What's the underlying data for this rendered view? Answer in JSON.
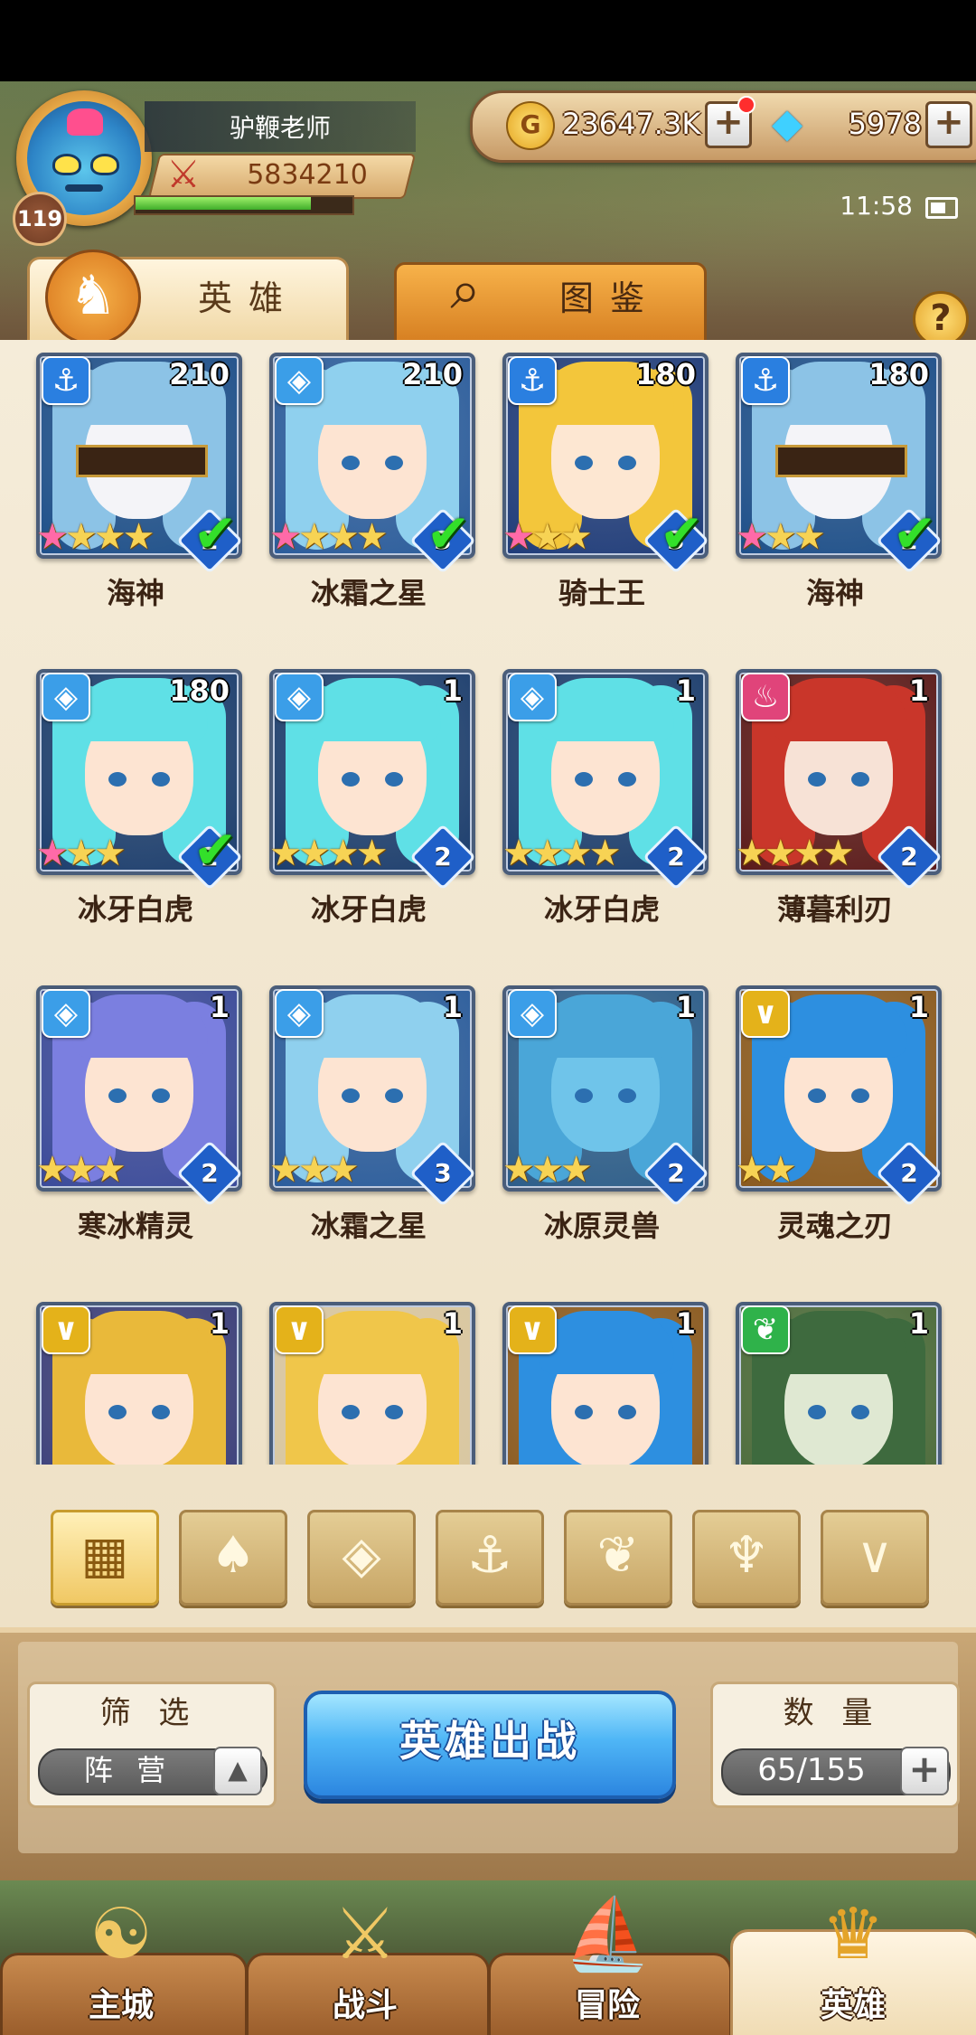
{
  "player": {
    "name": "驴鞭老师",
    "level": "119",
    "power": "5834210",
    "exp_fraction": 0.82
  },
  "resources": {
    "gold": "23647.3K",
    "gems": "5978"
  },
  "status": {
    "time": "11:58"
  },
  "tabs": {
    "heroes": "英雄",
    "atlas": "图鉴",
    "help": "?"
  },
  "heroes": [
    {
      "name": "海神",
      "level": "210",
      "faction": "anchor",
      "stars": 4,
      "rainbow": 1,
      "rank": "2",
      "checked": true,
      "hair": "#8cc3e6",
      "skin": "#f4f4f8",
      "bg": "#1d4f8a",
      "blind": true
    },
    {
      "name": "冰霜之星",
      "level": "210",
      "faction": "ice",
      "stars": 4,
      "rainbow": 1,
      "rank": "3",
      "checked": true,
      "hair": "#8fd0ee",
      "skin": "#fde4d2",
      "bg": "#2a5c9c",
      "blind": false
    },
    {
      "name": "骑士王",
      "level": "180",
      "faction": "anchor",
      "stars": 3,
      "rainbow": 1,
      "rank": "3",
      "checked": true,
      "hair": "#f3c63b",
      "skin": "#fde7d2",
      "bg": "#1f3c7a",
      "blind": false
    },
    {
      "name": "海神",
      "level": "180",
      "faction": "anchor",
      "stars": 3,
      "rainbow": 1,
      "rank": "2",
      "checked": true,
      "hair": "#8cc3e6",
      "skin": "#f4f4f8",
      "bg": "#1d4f8a",
      "blind": true
    },
    {
      "name": "冰牙白虎",
      "level": "180",
      "faction": "ice",
      "stars": 3,
      "rainbow": 1,
      "rank": "2",
      "checked": true,
      "hair": "#5fe0e6",
      "skin": "#fde4d2",
      "bg": "#1c3e6e",
      "blind": false
    },
    {
      "name": "冰牙白虎",
      "level": "1",
      "faction": "ice",
      "stars": 4,
      "rainbow": 0,
      "rank": "2",
      "checked": false,
      "hair": "#5fe0e6",
      "skin": "#fde4d2",
      "bg": "#1c3e6e",
      "blind": false
    },
    {
      "name": "冰牙白虎",
      "level": "1",
      "faction": "ice",
      "stars": 4,
      "rainbow": 0,
      "rank": "2",
      "checked": false,
      "hair": "#5fe0e6",
      "skin": "#fde4d2",
      "bg": "#1c3e6e",
      "blind": false
    },
    {
      "name": "薄暮利刃",
      "level": "1",
      "faction": "flame",
      "stars": 4,
      "rainbow": 0,
      "rank": "2",
      "checked": false,
      "hair": "#c9362a",
      "skin": "#f7e2d6",
      "bg": "#5a1a1a",
      "blind": false
    },
    {
      "name": "寒冰精灵",
      "level": "1",
      "faction": "ice",
      "stars": 3,
      "rainbow": 0,
      "rank": "2",
      "checked": false,
      "hair": "#7b7fe0",
      "skin": "#fde4d2",
      "bg": "#3a4a9a",
      "blind": false
    },
    {
      "name": "冰霜之星",
      "level": "1",
      "faction": "ice",
      "stars": 3,
      "rainbow": 0,
      "rank": "3",
      "checked": false,
      "hair": "#8fd0ee",
      "skin": "#fde4d2",
      "bg": "#2a5c9c",
      "blind": false
    },
    {
      "name": "冰原灵兽",
      "level": "1",
      "faction": "ice",
      "stars": 3,
      "rainbow": 0,
      "rank": "2",
      "checked": false,
      "hair": "#4aa6d8",
      "skin": "#6fc4ea",
      "bg": "#2c5d8a",
      "blind": false
    },
    {
      "name": "灵魂之刃",
      "level": "1",
      "faction": "wing",
      "stars": 2,
      "rainbow": 0,
      "rank": "2",
      "checked": false,
      "hair": "#2d8fe0",
      "skin": "#fde4d2",
      "bg": "#8a5a20",
      "blind": false
    },
    {
      "name": "",
      "level": "1",
      "faction": "wing",
      "stars": 0,
      "rainbow": 0,
      "rank": "",
      "checked": false,
      "hair": "#e9b93a",
      "skin": "#fde4d2",
      "bg": "#3a3e7a",
      "blind": false
    },
    {
      "name": "",
      "level": "1",
      "faction": "wing",
      "stars": 0,
      "rainbow": 0,
      "rank": "",
      "checked": false,
      "hair": "#f0c64a",
      "skin": "#fde4d2",
      "bg": "#d8c6a0",
      "blind": false
    },
    {
      "name": "",
      "level": "1",
      "faction": "wing",
      "stars": 0,
      "rainbow": 0,
      "rank": "",
      "checked": false,
      "hair": "#2d8fe0",
      "skin": "#fde4d2",
      "bg": "#8a5a20",
      "blind": false
    },
    {
      "name": "",
      "level": "1",
      "faction": "beast",
      "stars": 0,
      "rainbow": 0,
      "rank": "",
      "checked": false,
      "hair": "#3e6a3e",
      "skin": "#dfe8d2",
      "bg": "#4a6a3a",
      "blind": false
    }
  ],
  "faction_icons": {
    "anchor": {
      "glyph": "⚓",
      "color": "#2a7fe0",
      "name": "anchor-faction-icon"
    },
    "ice": {
      "glyph": "◈",
      "color": "#3b9ee8",
      "name": "ice-faction-icon"
    },
    "flame": {
      "glyph": "♨",
      "color": "#e0447a",
      "name": "flame-faction-icon"
    },
    "wing": {
      "glyph": "∨",
      "color": "#e4b21a",
      "name": "wing-faction-icon"
    },
    "beast": {
      "glyph": "❦",
      "color": "#2fb24a",
      "name": "beast-faction-icon"
    }
  },
  "filter_icons": [
    {
      "glyph": "▦",
      "name": "all-filter-icon",
      "active": true
    },
    {
      "glyph": "♠",
      "name": "flame-filter-icon",
      "active": false
    },
    {
      "glyph": "◈",
      "name": "ice-filter-icon",
      "active": false
    },
    {
      "glyph": "⚓",
      "name": "anchor-filter-icon",
      "active": false
    },
    {
      "glyph": "❦",
      "name": "beast-filter-icon",
      "active": false
    },
    {
      "glyph": "♆",
      "name": "demon-filter-icon",
      "active": false
    },
    {
      "glyph": "∨",
      "name": "wing-filter-icon",
      "active": false
    }
  ],
  "bottom": {
    "filter_title": "筛 选",
    "filter_value": "阵 营",
    "deploy": "英雄出战",
    "count_title": "数 量",
    "count_value": "65/155"
  },
  "nav": [
    {
      "label": "主城",
      "icon": "☯",
      "name": "nav-main-city",
      "active": false
    },
    {
      "label": "战斗",
      "icon": "⚔",
      "name": "nav-battle",
      "active": false
    },
    {
      "label": "冒险",
      "icon": "⛵",
      "name": "nav-adventure",
      "active": false
    },
    {
      "label": "英雄",
      "icon": "♛",
      "name": "nav-heroes",
      "active": true
    }
  ]
}
